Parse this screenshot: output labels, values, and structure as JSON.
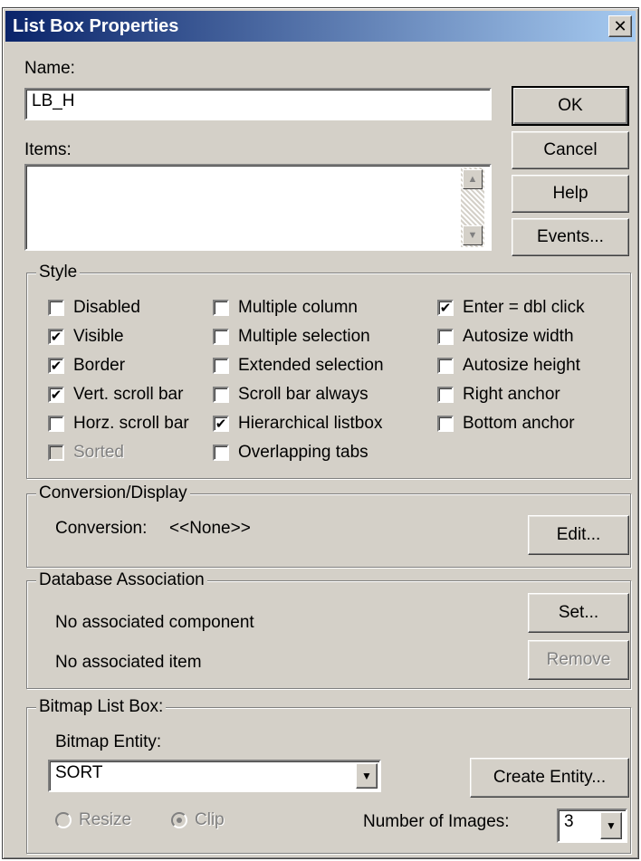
{
  "dialog": {
    "title": "List Box Properties",
    "close_glyph": "✕"
  },
  "name_field": {
    "label": "Name:",
    "value": "LB_H"
  },
  "items_field": {
    "label": "Items:"
  },
  "buttons": {
    "ok": "OK",
    "cancel": "Cancel",
    "help": "Help",
    "events": "Events..."
  },
  "style": {
    "title": "Style",
    "options": [
      {
        "label": "Disabled",
        "checked": false,
        "enabled": true
      },
      {
        "label": "Visible",
        "checked": true,
        "enabled": true
      },
      {
        "label": "Border",
        "checked": true,
        "enabled": true
      },
      {
        "label": "Vert. scroll bar",
        "checked": true,
        "enabled": true
      },
      {
        "label": "Horz. scroll bar",
        "checked": false,
        "enabled": true
      },
      {
        "label": "Sorted",
        "checked": false,
        "enabled": false
      },
      {
        "label": "Multiple column",
        "checked": false,
        "enabled": true
      },
      {
        "label": "Multiple selection",
        "checked": false,
        "enabled": true
      },
      {
        "label": "Extended selection",
        "checked": false,
        "enabled": true
      },
      {
        "label": "Scroll bar always",
        "checked": false,
        "enabled": true
      },
      {
        "label": "Hierarchical listbox",
        "checked": true,
        "enabled": true
      },
      {
        "label": "Overlapping tabs",
        "checked": false,
        "enabled": true
      },
      {
        "label": "Enter = dbl click",
        "checked": true,
        "enabled": true
      },
      {
        "label": "Autosize width",
        "checked": false,
        "enabled": true
      },
      {
        "label": "Autosize height",
        "checked": false,
        "enabled": true
      },
      {
        "label": "Right anchor",
        "checked": false,
        "enabled": true
      },
      {
        "label": "Bottom anchor",
        "checked": false,
        "enabled": true
      }
    ]
  },
  "conversion": {
    "title": "Conversion/Display",
    "label": "Conversion:",
    "value": "<<None>>",
    "edit_button": "Edit..."
  },
  "database": {
    "title": "Database Association",
    "component_text": "No associated component",
    "item_text": "No associated item",
    "set_button": "Set...",
    "remove_button": "Remove"
  },
  "bitmap": {
    "title": "Bitmap List Box:",
    "entity_label": "Bitmap Entity:",
    "entity_value": "SORT",
    "create_button": "Create Entity...",
    "resize_label": "Resize",
    "clip_label": "Clip",
    "images_label": "Number of Images:",
    "images_value": "3"
  },
  "glyphs": {
    "check": "✔",
    "arrow_down": "▼",
    "arrow_up": "▲"
  }
}
